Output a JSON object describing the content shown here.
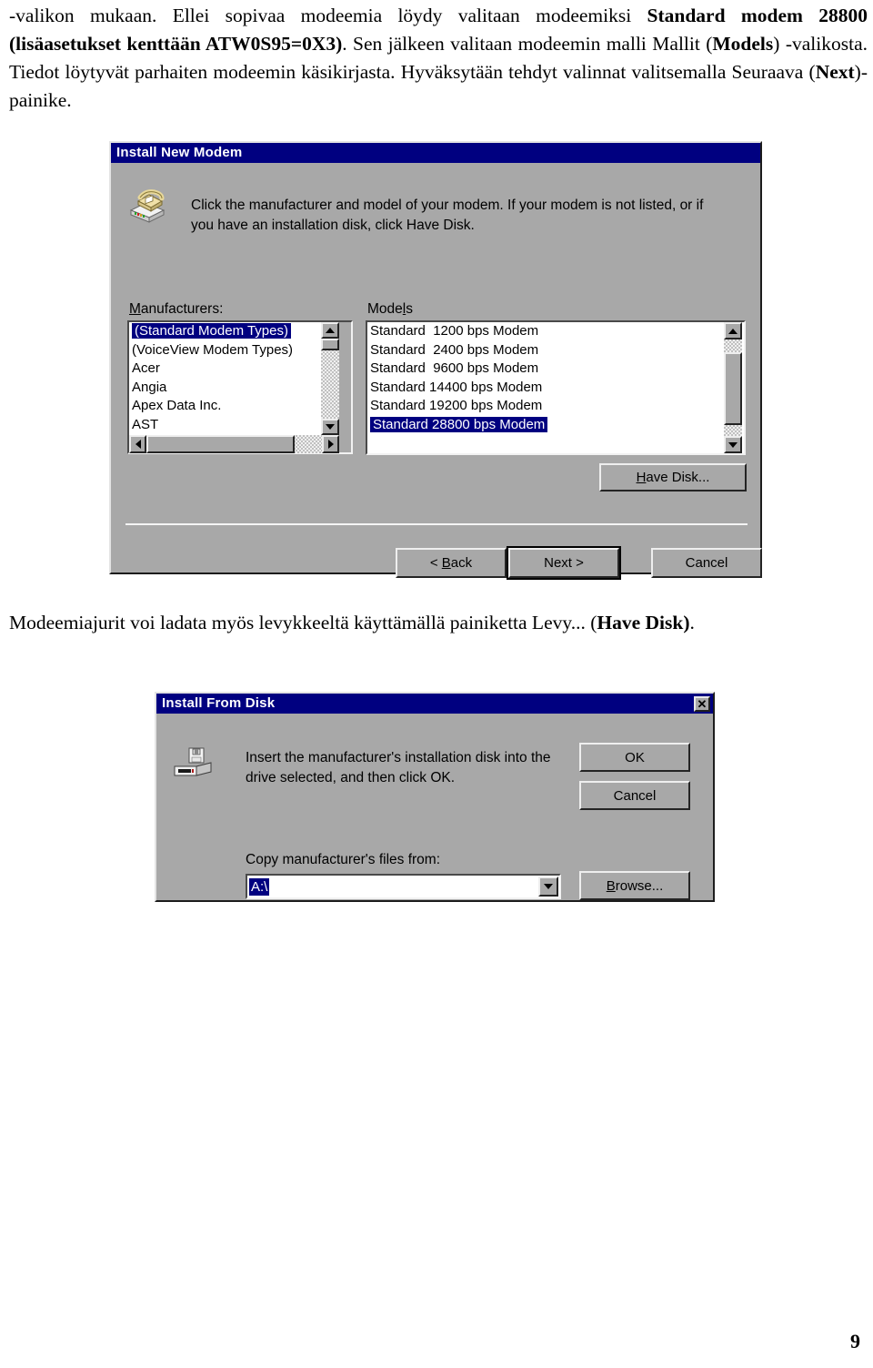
{
  "document": {
    "intro_paragraph_parts": [
      {
        "text": "-valikon mukaan. Ellei sopivaa modeemia löydy valitaan modeemiksi ",
        "bold": false
      },
      {
        "text": "Standard modem 28800 (lisäasetukset kenttään ATW0S95=0X3)",
        "bold": true
      },
      {
        "text": ". Sen jälkeen valitaan modeemin malli Mallit (",
        "bold": false
      },
      {
        "text": "Models",
        "bold": true
      },
      {
        "text": ") -valikosta.  Tiedot löytyvät parhaiten modeemin käsikirjasta. Hyväksytään tehdyt valinnat valitsemalla Seuraava (",
        "bold": false
      },
      {
        "text": "Next",
        "bold": true
      },
      {
        "text": ")- painike.",
        "bold": false
      }
    ],
    "middle_paragraph_parts": [
      {
        "text": "Modeemiajurit voi ladata myös levykkeeltä käyttämällä painiketta Levy... (",
        "bold": false
      },
      {
        "text": "Have Disk)",
        "bold": true
      },
      {
        "text": ".",
        "bold": false
      }
    ],
    "page_number": "9"
  },
  "colors": {
    "titlebar": "#000080",
    "dialog_face": "#a8a8a8",
    "selection": "#000080",
    "selection_text": "#ffffff",
    "window_white": "#ffffff"
  },
  "dialog_install_new_modem": {
    "title": "Install New Modem",
    "icon": "modem-phone-icon",
    "instruction": "Click the manufacturer and model of your modem. If your modem is not listed, or if you have an installation disk, click Have Disk.",
    "manufacturers_label": "Manufacturers:",
    "manufacturers_label_mnemonic": "M",
    "models_label": "Models",
    "models_label_mnemonic": "l",
    "manufacturers": [
      {
        "label": "(Standard Modem Types)",
        "selected": true
      },
      {
        "label": "(VoiceView Modem Types)",
        "selected": false
      },
      {
        "label": "Acer",
        "selected": false
      },
      {
        "label": "Angia",
        "selected": false
      },
      {
        "label": "Apex Data Inc.",
        "selected": false
      },
      {
        "label": "AST",
        "selected": false
      }
    ],
    "models": [
      {
        "label": "Standard  1200 bps Modem",
        "selected": false
      },
      {
        "label": "Standard  2400 bps Modem",
        "selected": false
      },
      {
        "label": "Standard  9600 bps Modem",
        "selected": false
      },
      {
        "label": "Standard 14400 bps Modem",
        "selected": false
      },
      {
        "label": "Standard 19200 bps Modem",
        "selected": false
      },
      {
        "label": "Standard 28800 bps Modem",
        "selected": true
      }
    ],
    "buttons": {
      "have_disk": "Have Disk...",
      "have_disk_mnemonic": "H",
      "back": "< Back",
      "back_mnemonic": "B",
      "next": "Next >",
      "cancel": "Cancel"
    }
  },
  "dialog_install_from_disk": {
    "title": "Install From Disk",
    "close_label": "✕",
    "icon": "floppy-drive-icon",
    "instruction": "Insert the manufacturer's installation disk into the drive selected, and then click OK.",
    "copy_from_label": "Copy manufacturer's files from:",
    "path_value": "A:\\",
    "buttons": {
      "ok": "OK",
      "cancel": "Cancel",
      "browse": "Browse...",
      "browse_mnemonic": "B"
    }
  }
}
